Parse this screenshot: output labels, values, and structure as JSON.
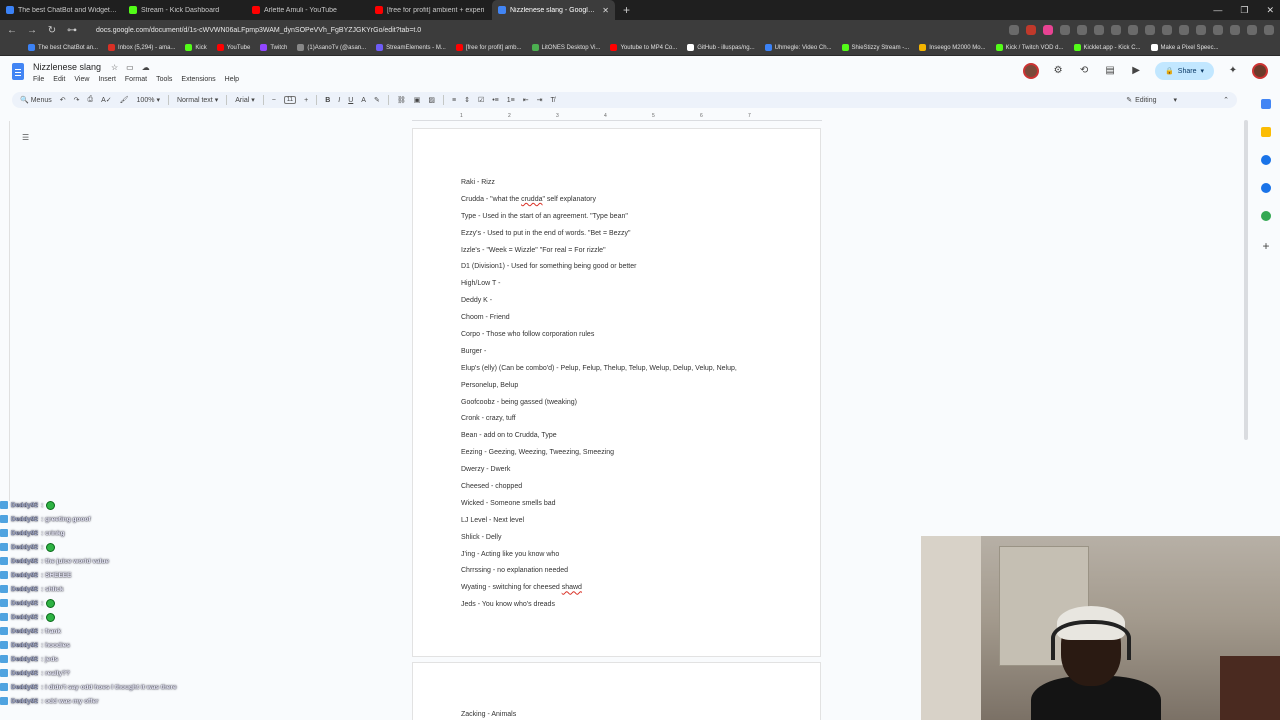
{
  "browser": {
    "tabs": [
      {
        "label": "The best ChatBot and Widgets for Ki",
        "color": "#3b82f6",
        "active": false
      },
      {
        "label": "Stream - Kick Dashboard",
        "color": "#53fc18",
        "active": false
      },
      {
        "label": "Arlette Amuli - YouTube",
        "color": "#ff0000",
        "active": false
      },
      {
        "label": "[free for profit] ambient + experi",
        "color": "#ff0000",
        "active": false
      },
      {
        "label": "Nizzlenese slang - Google Docs",
        "color": "#4285f4",
        "active": true
      }
    ],
    "new_tab": "+",
    "url": "docs.google.com/document/d/1s-cWVWN06aLFpmp3WAM_dynSOPeVVh_FgBYZJGKYrGo/edit?tab=t.0",
    "bookmarks": [
      {
        "label": "The best ChatBot an...",
        "color": "#3b82f6"
      },
      {
        "label": "Inbox (5,294) - ama...",
        "color": "#d93025"
      },
      {
        "label": "Kick",
        "color": "#53fc18"
      },
      {
        "label": "YouTube",
        "color": "#ff0000"
      },
      {
        "label": "Twitch",
        "color": "#9146ff"
      },
      {
        "label": "(1)AsanoTv (@asan...",
        "color": "#888888"
      },
      {
        "label": "StreamElements - M...",
        "color": "#6e5cf6"
      },
      {
        "label": "[free for profit] amb...",
        "color": "#ff0000"
      },
      {
        "label": "LitONES Desktop Vi...",
        "color": "#4caf50"
      },
      {
        "label": "Youtube to MP4 Co...",
        "color": "#ff0000"
      },
      {
        "label": "GitHub - illuspas/ng...",
        "color": "#ffffff"
      },
      {
        "label": "Uhmegle: Video Ch...",
        "color": "#3b82f6"
      },
      {
        "label": "ShieStizzy Stream -...",
        "color": "#53fc18"
      },
      {
        "label": "Inseego M2000 Mo...",
        "color": "#f4b400"
      },
      {
        "label": "Kick / Twitch VOD d...",
        "color": "#53fc18"
      },
      {
        "label": "Kicklet.app - Kick C...",
        "color": "#53fc18"
      },
      {
        "label": "Make a Pixel Speec...",
        "color": "#ffffff"
      }
    ]
  },
  "doc": {
    "title": "Nizzlenese slang",
    "menu": [
      "File",
      "Edit",
      "View",
      "Insert",
      "Format",
      "Tools",
      "Extensions",
      "Help"
    ],
    "share_label": "Share",
    "toolbar": {
      "menus_label": "Menus",
      "zoom": "100%",
      "style": "Normal text",
      "font": "Arial",
      "font_size": "11",
      "mode": "Editing"
    },
    "ruler_marks": [
      "1",
      "2",
      "3",
      "4",
      "5",
      "6",
      "7"
    ],
    "lines": [
      "Raki - Rizz",
      "Crudda - \"what the crudda\" self explanatory",
      "Type - Used in the start of an agreement. \"Type bean\"",
      "Ezzy's - Used to put in the end of words. \"Bet = Bezzy\"",
      "Izzle's - \"Week = Wizzle\" \"For real = For rizzle\"",
      "D1 (Division1) - Used for something being good or better",
      "High/Low T -",
      "Deddy K -",
      "Choom - Friend",
      "Corpo - Those who follow corporation rules",
      "Burger -",
      "Elup's (elly) (Can be combo'd) - Pelup, Felup, Thelup, Telup, Welup, Delup, Velup, Nelup,",
      "Personelup, Belup",
      "Goofcoobz - being gassed (tweaking)",
      "Cronk - crazy, tuff",
      "Bean - add on to Crudda, Type",
      "Eezing - Geezing, Weezing, Tweezing, Smeezing",
      "Dwerzy - Dwerk",
      "Cheesed - chopped",
      "Wicked - Someone smells bad",
      "LJ Level - Next level",
      "Shlick - Delly",
      "J'ing - Acting like you know who",
      "Chrrssing - no explanation needed",
      "Wyating - switching for cheesed shawd",
      "Jeds - You know who's dreads"
    ],
    "page2_line": "Zacking - Animals"
  },
  "chat": [
    {
      "name": "Deddy92",
      "msg": ":",
      "emote": true
    },
    {
      "name": "Deddy92",
      "msg": ": greeting gooof",
      "emote": false
    },
    {
      "name": "Deddy92",
      "msg": ": crinkg",
      "emote": false
    },
    {
      "name": "Deddy92",
      "msg": ":",
      "emote": true
    },
    {
      "name": "Deddy92",
      "msg": ": the juice world value",
      "emote": false
    },
    {
      "name": "Deddy92",
      "msg": ": SHEEEE",
      "emote": false
    },
    {
      "name": "Deddy92",
      "msg": ": shlick",
      "emote": false
    },
    {
      "name": "Deddy92",
      "msg": ":",
      "emote": true
    },
    {
      "name": "Deddy92",
      "msg": ":",
      "emote": true
    },
    {
      "name": "Deddy92",
      "msg": ": frank",
      "emote": false
    },
    {
      "name": "Deddy92",
      "msg": ": hoodies",
      "emote": false
    },
    {
      "name": "Deddy92",
      "msg": ": jeds",
      "emote": false
    },
    {
      "name": "Deddy92",
      "msg": ": really??",
      "emote": false
    },
    {
      "name": "Deddy92",
      "msg": ": i didn't say odd hoes I thought it was there",
      "emote": false
    },
    {
      "name": "Deddy92",
      "msg": ": odd was my offer",
      "emote": false
    }
  ]
}
